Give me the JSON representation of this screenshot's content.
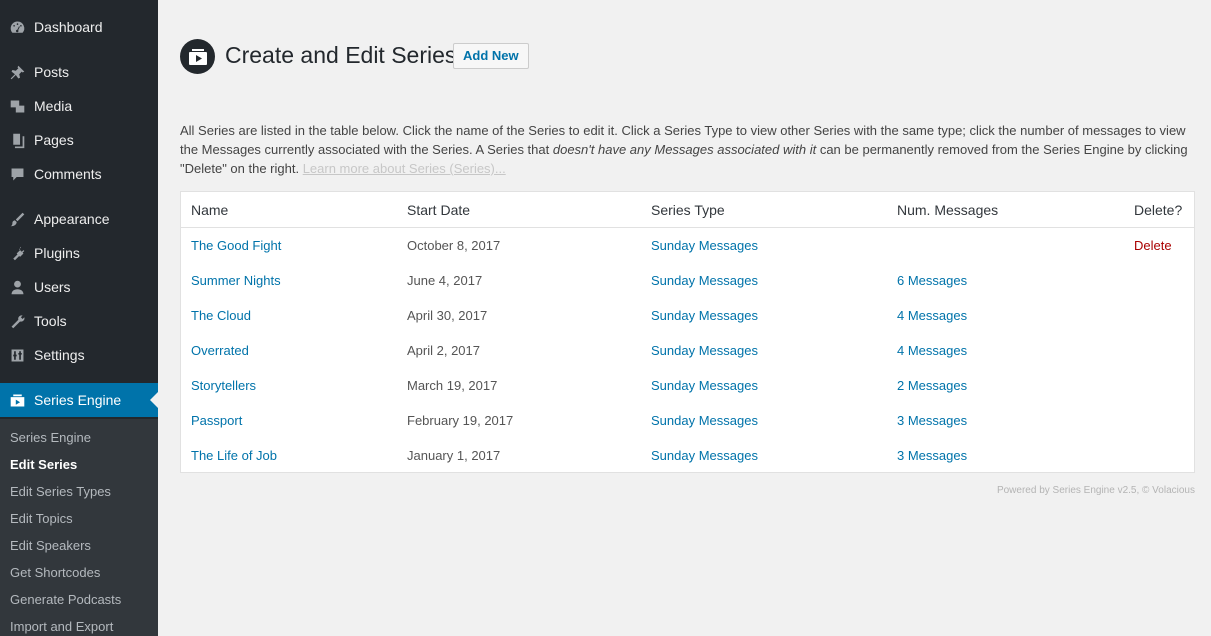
{
  "sidebar": {
    "items": [
      {
        "label": "Dashboard",
        "icon": "dashboard-icon"
      },
      {
        "label": "Posts",
        "icon": "pin-icon"
      },
      {
        "label": "Media",
        "icon": "media-icon"
      },
      {
        "label": "Pages",
        "icon": "pages-icon"
      },
      {
        "label": "Comments",
        "icon": "comment-icon"
      },
      {
        "label": "Appearance",
        "icon": "brush-icon"
      },
      {
        "label": "Plugins",
        "icon": "plug-icon"
      },
      {
        "label": "Users",
        "icon": "user-icon"
      },
      {
        "label": "Tools",
        "icon": "wrench-icon"
      },
      {
        "label": "Settings",
        "icon": "settings-icon"
      },
      {
        "label": "Series Engine",
        "icon": "series-engine-icon"
      }
    ],
    "submenu": [
      "Series Engine",
      "Edit Series",
      "Edit Series Types",
      "Edit Topics",
      "Edit Speakers",
      "Get Shortcodes",
      "Generate Podcasts",
      "Import and Export"
    ]
  },
  "header": {
    "title": "Create and Edit Series",
    "add_new": "Add New"
  },
  "description": {
    "part1": "All Series are listed in the table below. Click the name of the Series to edit it. Click a Series Type to view other Series with the same type; click the number of messages to view the Messages currently associated with the Series. A Series that ",
    "emphasis": "doesn't have any Messages associated with it",
    "part2": " can be permanently removed from the Series Engine by clicking \"Delete\" on the right. ",
    "learn_more": "Learn more about Series (Series)..."
  },
  "table": {
    "headers": [
      "Name",
      "Start Date",
      "Series Type",
      "Num. Messages",
      "Delete?"
    ],
    "rows": [
      {
        "name": "The Good Fight",
        "date": "October 8, 2017",
        "type": "Sunday Messages",
        "messages": "",
        "delete": "Delete"
      },
      {
        "name": "Summer Nights",
        "date": "June 4, 2017",
        "type": "Sunday Messages",
        "messages": "6 Messages",
        "delete": ""
      },
      {
        "name": "The Cloud",
        "date": "April 30, 2017",
        "type": "Sunday Messages",
        "messages": "4 Messages",
        "delete": ""
      },
      {
        "name": "Overrated",
        "date": "April 2, 2017",
        "type": "Sunday Messages",
        "messages": "4 Messages",
        "delete": ""
      },
      {
        "name": "Storytellers",
        "date": "March 19, 2017",
        "type": "Sunday Messages",
        "messages": "2 Messages",
        "delete": ""
      },
      {
        "name": "Passport",
        "date": "February 19, 2017",
        "type": "Sunday Messages",
        "messages": "3 Messages",
        "delete": ""
      },
      {
        "name": "The Life of Job",
        "date": "January 1, 2017",
        "type": "Sunday Messages",
        "messages": "3 Messages",
        "delete": ""
      }
    ]
  },
  "footer": "Powered by Series Engine v2.5, © Volacious",
  "colors": {
    "accent": "#0073aa",
    "sidebar_bg": "#23282d",
    "delete": "#aa0000"
  }
}
